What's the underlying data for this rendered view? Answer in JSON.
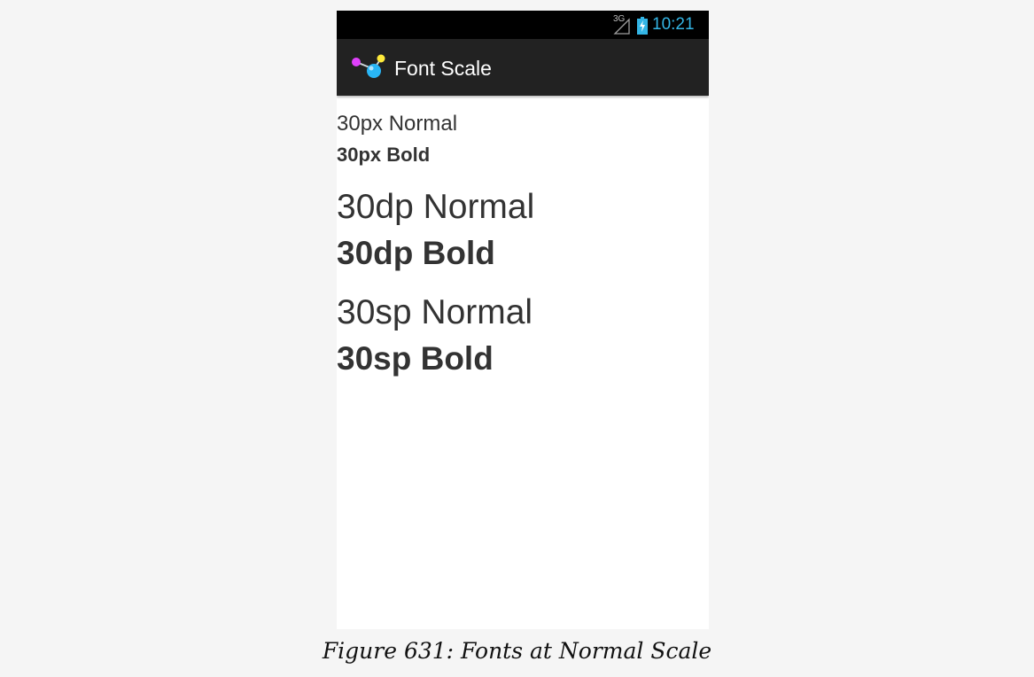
{
  "status_bar": {
    "network_type": "3G",
    "time": "10:21",
    "icons": [
      "signal-icon",
      "battery-charging-icon"
    ]
  },
  "action_bar": {
    "app_icon": "app-icon",
    "title": "Font Scale"
  },
  "samples": {
    "px_normal": "30px Normal",
    "px_bold": "30px Bold",
    "dp_normal": "30dp Normal",
    "dp_bold": "30dp Bold",
    "sp_normal": "30sp Normal",
    "sp_bold": "30sp Bold"
  },
  "caption": "Figure 631: Fonts at Normal Scale",
  "colors": {
    "status_bar_bg": "#000000",
    "clock": "#33b5e5",
    "action_bar_bg": "#222222",
    "text": "#333333",
    "screen_bg": "#ffffff",
    "page_bg": "#f5f5f5"
  }
}
